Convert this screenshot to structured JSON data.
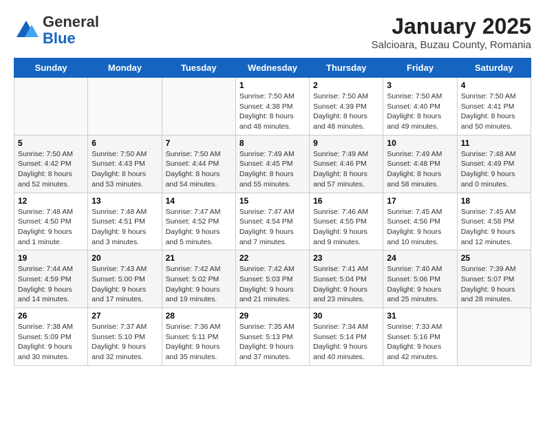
{
  "logo": {
    "general": "General",
    "blue": "Blue"
  },
  "title": "January 2025",
  "location": "Salcioara, Buzau County, Romania",
  "days_of_week": [
    "Sunday",
    "Monday",
    "Tuesday",
    "Wednesday",
    "Thursday",
    "Friday",
    "Saturday"
  ],
  "weeks": [
    [
      {
        "day": "",
        "info": ""
      },
      {
        "day": "",
        "info": ""
      },
      {
        "day": "",
        "info": ""
      },
      {
        "day": "1",
        "info": "Sunrise: 7:50 AM\nSunset: 4:38 PM\nDaylight: 8 hours\nand 48 minutes."
      },
      {
        "day": "2",
        "info": "Sunrise: 7:50 AM\nSunset: 4:39 PM\nDaylight: 8 hours\nand 48 minutes."
      },
      {
        "day": "3",
        "info": "Sunrise: 7:50 AM\nSunset: 4:40 PM\nDaylight: 8 hours\nand 49 minutes."
      },
      {
        "day": "4",
        "info": "Sunrise: 7:50 AM\nSunset: 4:41 PM\nDaylight: 8 hours\nand 50 minutes."
      }
    ],
    [
      {
        "day": "5",
        "info": "Sunrise: 7:50 AM\nSunset: 4:42 PM\nDaylight: 8 hours\nand 52 minutes."
      },
      {
        "day": "6",
        "info": "Sunrise: 7:50 AM\nSunset: 4:43 PM\nDaylight: 8 hours\nand 53 minutes."
      },
      {
        "day": "7",
        "info": "Sunrise: 7:50 AM\nSunset: 4:44 PM\nDaylight: 8 hours\nand 54 minutes."
      },
      {
        "day": "8",
        "info": "Sunrise: 7:49 AM\nSunset: 4:45 PM\nDaylight: 8 hours\nand 55 minutes."
      },
      {
        "day": "9",
        "info": "Sunrise: 7:49 AM\nSunset: 4:46 PM\nDaylight: 8 hours\nand 57 minutes."
      },
      {
        "day": "10",
        "info": "Sunrise: 7:49 AM\nSunset: 4:48 PM\nDaylight: 8 hours\nand 58 minutes."
      },
      {
        "day": "11",
        "info": "Sunrise: 7:48 AM\nSunset: 4:49 PM\nDaylight: 9 hours\nand 0 minutes."
      }
    ],
    [
      {
        "day": "12",
        "info": "Sunrise: 7:48 AM\nSunset: 4:50 PM\nDaylight: 9 hours\nand 1 minute."
      },
      {
        "day": "13",
        "info": "Sunrise: 7:48 AM\nSunset: 4:51 PM\nDaylight: 9 hours\nand 3 minutes."
      },
      {
        "day": "14",
        "info": "Sunrise: 7:47 AM\nSunset: 4:52 PM\nDaylight: 9 hours\nand 5 minutes."
      },
      {
        "day": "15",
        "info": "Sunrise: 7:47 AM\nSunset: 4:54 PM\nDaylight: 9 hours\nand 7 minutes."
      },
      {
        "day": "16",
        "info": "Sunrise: 7:46 AM\nSunset: 4:55 PM\nDaylight: 9 hours\nand 9 minutes."
      },
      {
        "day": "17",
        "info": "Sunrise: 7:45 AM\nSunset: 4:56 PM\nDaylight: 9 hours\nand 10 minutes."
      },
      {
        "day": "18",
        "info": "Sunrise: 7:45 AM\nSunset: 4:58 PM\nDaylight: 9 hours\nand 12 minutes."
      }
    ],
    [
      {
        "day": "19",
        "info": "Sunrise: 7:44 AM\nSunset: 4:59 PM\nDaylight: 9 hours\nand 14 minutes."
      },
      {
        "day": "20",
        "info": "Sunrise: 7:43 AM\nSunset: 5:00 PM\nDaylight: 9 hours\nand 17 minutes."
      },
      {
        "day": "21",
        "info": "Sunrise: 7:42 AM\nSunset: 5:02 PM\nDaylight: 9 hours\nand 19 minutes."
      },
      {
        "day": "22",
        "info": "Sunrise: 7:42 AM\nSunset: 5:03 PM\nDaylight: 9 hours\nand 21 minutes."
      },
      {
        "day": "23",
        "info": "Sunrise: 7:41 AM\nSunset: 5:04 PM\nDaylight: 9 hours\nand 23 minutes."
      },
      {
        "day": "24",
        "info": "Sunrise: 7:40 AM\nSunset: 5:06 PM\nDaylight: 9 hours\nand 25 minutes."
      },
      {
        "day": "25",
        "info": "Sunrise: 7:39 AM\nSunset: 5:07 PM\nDaylight: 9 hours\nand 28 minutes."
      }
    ],
    [
      {
        "day": "26",
        "info": "Sunrise: 7:38 AM\nSunset: 5:09 PM\nDaylight: 9 hours\nand 30 minutes."
      },
      {
        "day": "27",
        "info": "Sunrise: 7:37 AM\nSunset: 5:10 PM\nDaylight: 9 hours\nand 32 minutes."
      },
      {
        "day": "28",
        "info": "Sunrise: 7:36 AM\nSunset: 5:11 PM\nDaylight: 9 hours\nand 35 minutes."
      },
      {
        "day": "29",
        "info": "Sunrise: 7:35 AM\nSunset: 5:13 PM\nDaylight: 9 hours\nand 37 minutes."
      },
      {
        "day": "30",
        "info": "Sunrise: 7:34 AM\nSunset: 5:14 PM\nDaylight: 9 hours\nand 40 minutes."
      },
      {
        "day": "31",
        "info": "Sunrise: 7:33 AM\nSunset: 5:16 PM\nDaylight: 9 hours\nand 42 minutes."
      },
      {
        "day": "",
        "info": ""
      }
    ]
  ]
}
